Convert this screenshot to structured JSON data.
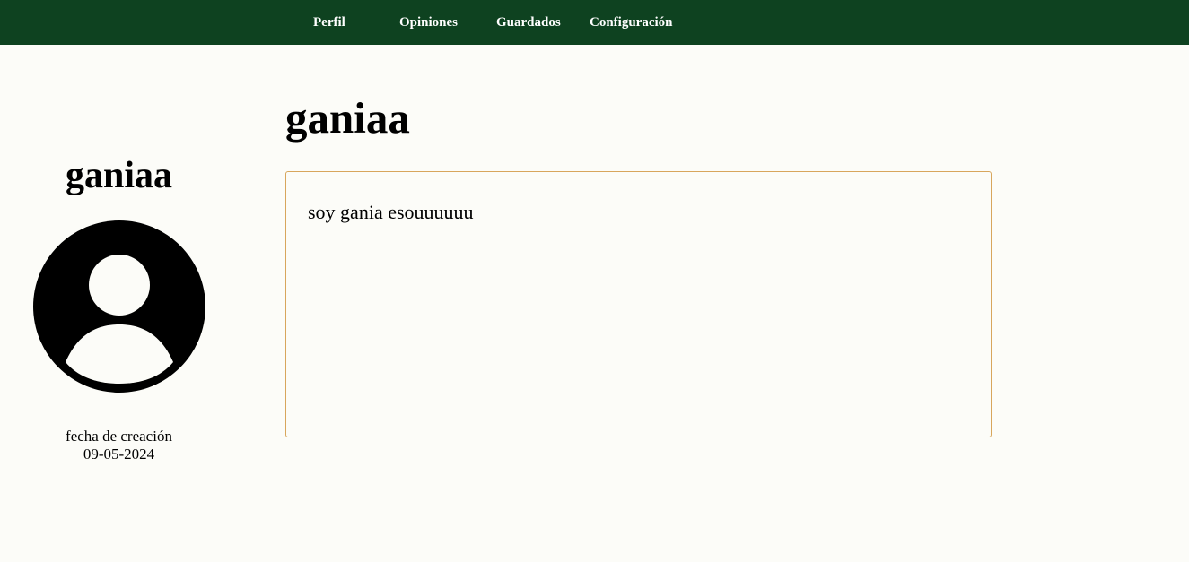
{
  "nav": {
    "items": [
      {
        "label": "Perfil"
      },
      {
        "label": "Opiniones"
      },
      {
        "label": "Guardados"
      },
      {
        "label": "Configuración"
      }
    ],
    "background": "#0e4220",
    "text_color": "#ffffff"
  },
  "sidebar": {
    "username": "ganiaa",
    "avatar_icon": "user-avatar-icon",
    "created_label": "fecha de creación",
    "created_date": "09-05-2024"
  },
  "main": {
    "username": "ganiaa",
    "bio": "soy gania esouuuuuu",
    "bio_border_color": "#d8a65c"
  },
  "page_background": "#fcfcf8"
}
